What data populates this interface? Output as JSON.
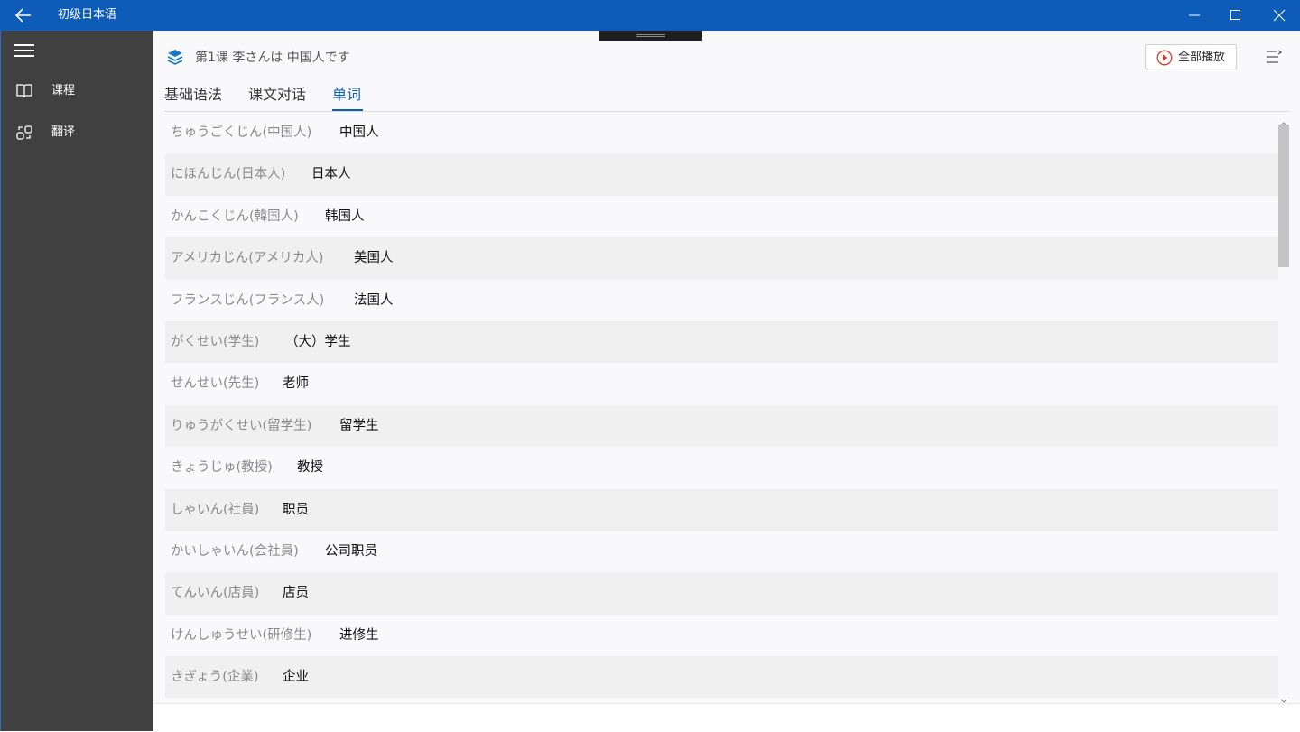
{
  "window": {
    "title": "初级日本语",
    "accent": "#0c5cb8"
  },
  "sidebar": {
    "items": [
      {
        "label": "课程",
        "icon": "book-icon"
      },
      {
        "label": "翻译",
        "icon": "translate-icon"
      }
    ]
  },
  "header": {
    "lesson_title": "第1课  李さんは 中国人です",
    "play_all_label": "全部播放"
  },
  "tabs": [
    {
      "label": "基础语法",
      "active": false
    },
    {
      "label": "课文对话",
      "active": false
    },
    {
      "label": "单词",
      "active": true
    }
  ],
  "vocab": [
    {
      "kana": "ちゅうごくじん(中国人)",
      "meaning": "中国人"
    },
    {
      "kana": "にほんじん(日本人)",
      "meaning": "日本人"
    },
    {
      "kana": "かんこくじん(韓国人)",
      "meaning": "韩国人"
    },
    {
      "kana": "アメリカじん(アメリカ人)",
      "meaning": "美国人"
    },
    {
      "kana": "フランスじん(フランス人)",
      "meaning": "法国人"
    },
    {
      "kana": "がくせい(学生)",
      "meaning": "（大）学生"
    },
    {
      "kana": "せんせい(先生)",
      "meaning": "老师"
    },
    {
      "kana": "りゅうがくせい(留学生)",
      "meaning": "留学生"
    },
    {
      "kana": "きょうじゅ(教授)",
      "meaning": "教授"
    },
    {
      "kana": "しゃいん(社員)",
      "meaning": "职员"
    },
    {
      "kana": "かいしゃいん(会社員)",
      "meaning": "公司职员"
    },
    {
      "kana": "てんいん(店員)",
      "meaning": "店员"
    },
    {
      "kana": "けんしゅうせい(研修生)",
      "meaning": "进修生"
    },
    {
      "kana": "きぎょう(企業)",
      "meaning": "企业"
    }
  ]
}
